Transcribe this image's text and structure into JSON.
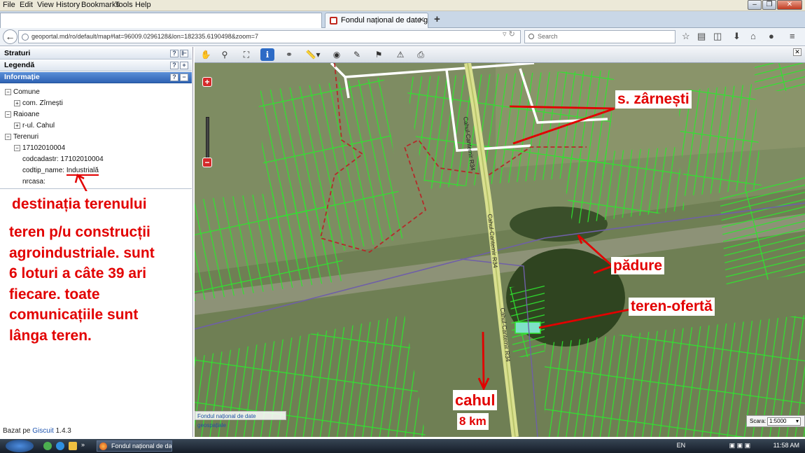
{
  "menubar": [
    "File",
    "Edit",
    "View",
    "History",
    "Bookmarks",
    "Tools",
    "Help"
  ],
  "browser": {
    "tab_title": "Fondul național de date geos...",
    "url": "geoportal.md/ro/default/map#lat=96009.0296128&lon=182335.6190498&zoom=7",
    "search_placeholder": "Search"
  },
  "sidebar": {
    "strati": "Straturi",
    "legenda": "Legendă",
    "informatie": "Informație",
    "tree": {
      "comune": "Comune",
      "comune_item": "com. Zîrnești",
      "raioane": "Raioane",
      "raioane_item": "r-ul. Cahul",
      "terenuri": "Terenuri",
      "teren_id": "17102010004",
      "codcadastr": "codcadastr: 17102010004",
      "codtip_label": "codtip_name:",
      "codtip_value": "Industrială",
      "nrcasa": "nrcasa:"
    },
    "annotation_dest": "destinația terenului",
    "annotation_text": [
      "teren p/u construcții",
      "agroindustriale. sunt",
      "6 loturi a câte 39 ari",
      "fiecare. toate",
      "comunicațiile sunt",
      "lânga teren."
    ],
    "bazat_prefix": "Bazat pe",
    "bazat_link": "Giscuit",
    "bazat_version": "1.4.3"
  },
  "map": {
    "labels": {
      "village": "s. zârnești",
      "forest": "pădure",
      "offer": "teren-ofertă",
      "city": "cahul",
      "distance": "8 km"
    },
    "road_labels": [
      "Cahul-Cantemir R34",
      "Cahul-Cantemir R34",
      "Cahul-Cantemir R34"
    ],
    "attribution": "Fondul național de date geospațiale",
    "scale_label": "Scara:",
    "scale_value": "1:5000"
  },
  "taskbar": {
    "task": "Fondul național de da...",
    "lang": "EN",
    "time": "11:58 AM"
  }
}
